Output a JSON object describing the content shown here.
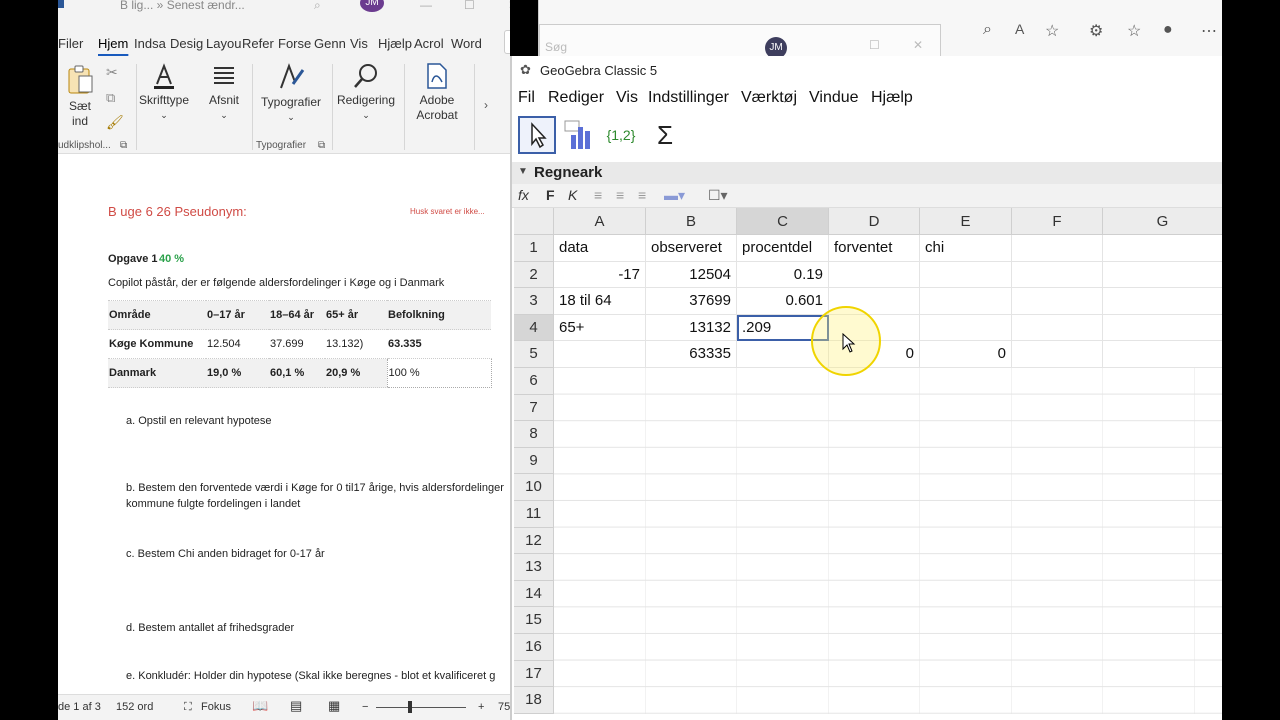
{
  "word": {
    "title": "B lig... » Senest ændr...",
    "avatar": "JM",
    "tabs": [
      "Filer",
      "Hjem",
      "Indsa",
      "Desig",
      "Layou",
      "Refer",
      "Forse",
      "Genn",
      "Vis",
      "Hjælp",
      "Acrol",
      "Word"
    ],
    "ribbon": {
      "paste_label1": "Sæt",
      "paste_label2": "ind",
      "clipboard_group": "udklipshol...",
      "font_label": "Skrifttype",
      "paragraph_label": "Afsnit",
      "styles_label": "Typografier",
      "styles_group": "Typografier",
      "editing_label": "Redigering",
      "acrobat_label1": "Adobe",
      "acrobat_label2": "Acrobat"
    },
    "doc": {
      "header_left": "B uge 6 26   Pseudonym:",
      "header_right": "Husk svaret er ikke...",
      "task_title": "Opgave 1",
      "task_points": "40 %",
      "intro": "Copilot påstår, der er følgende aldersfordelinger i Køge og i Danmark",
      "table": {
        "headers": [
          "Område",
          "0–17 år",
          "18–64 år",
          "65+ år",
          "Befolkning"
        ],
        "rows": [
          [
            "Køge Kommune",
            "12.504",
            "37.699",
            "13.132)",
            "63.335"
          ],
          [
            "Danmark",
            "19,0 %",
            "60,1 %",
            "20,9 %",
            "100 %"
          ]
        ]
      },
      "items": [
        "a.   Opstil en relevant hypotese",
        "b.   Bestem den forventede værdi i Køge for 0 til17 årige, hvis aldersfordelinger",
        "      kommune fulgte fordelingen i landet",
        "c.   Bestem Chi anden bidraget for 0-17 år",
        "d.   Bestem antallet af frihedsgrader",
        "e.   Konkludér: Holder din hypotese (Skal ikke beregnes - blot et kvalificeret g"
      ]
    },
    "status": {
      "page": "de 1 af 3",
      "words": "152 ord",
      "focus": "Fokus",
      "zoom": "75"
    }
  },
  "browser": {
    "search_placeholder": "Søg",
    "avatar": "JM"
  },
  "geogebra": {
    "title": "GeoGebra Classic 5",
    "menu": [
      "Fil",
      "Rediger",
      "Vis",
      "Indstillinger",
      "Værktøj",
      "Vindue",
      "Hjælp"
    ],
    "tools": {
      "list_label": "{1,2}",
      "sum_label": "Σ"
    },
    "panel_title": "Regneark",
    "format": {
      "bold": "F",
      "italic": "K"
    },
    "columns": [
      "A",
      "B",
      "C",
      "D",
      "E",
      "F",
      "G"
    ],
    "rows": [
      "1",
      "2",
      "3",
      "4",
      "5",
      "6",
      "7",
      "8",
      "9",
      "10",
      "11",
      "12",
      "13",
      "14",
      "15",
      "16",
      "17",
      "18"
    ],
    "cells": {
      "A1": "data",
      "B1": "observeret",
      "C1": "procentdel",
      "D1": "forventet",
      "E1": "chi",
      "A2": "-17",
      "B2": "12504",
      "C2": "0.19",
      "A3": "18 til 64",
      "B3": "37699",
      "C3": "0.601",
      "A4": "65+",
      "B4": "13132",
      "C4": ".209",
      "B5": "63335",
      "D5": "0",
      "E5": "0"
    }
  }
}
